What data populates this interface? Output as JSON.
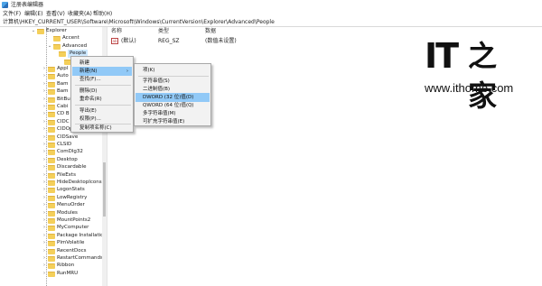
{
  "window": {
    "title": "注册表编辑器"
  },
  "menubar": [
    "文件(F)",
    "编辑(E)",
    "查看(V)",
    "收藏夹(A)",
    "帮助(H)"
  ],
  "address": "计算机\\HKEY_CURRENT_USER\\Software\\Microsoft\\Windows\\CurrentVersion\\Explorer\\Advanced\\People",
  "tree": {
    "items": [
      {
        "label": "Explorer",
        "expander": "⌄"
      },
      {
        "label": "Accent",
        "expander": ""
      },
      {
        "label": "Advanced",
        "expander": "⌄"
      },
      {
        "label": "People",
        "expander": ""
      },
      {
        "label": "Xa",
        "expander": ""
      },
      {
        "label": "Appl",
        "expander": "›"
      },
      {
        "label": "Auto",
        "expander": "›"
      },
      {
        "label": "Bam",
        "expander": "›"
      },
      {
        "label": "Bam",
        "expander": "›"
      },
      {
        "label": "BitBu",
        "expander": "›"
      },
      {
        "label": "Cabi",
        "expander": "›"
      },
      {
        "label": "CD B",
        "expander": "›"
      },
      {
        "label": "CIDC",
        "expander": "›"
      },
      {
        "label": "CIDOpen",
        "expander": "›"
      },
      {
        "label": "CIDSave",
        "expander": "›"
      },
      {
        "label": "CLSID",
        "expander": "›"
      },
      {
        "label": "ComDlg32",
        "expander": "›"
      },
      {
        "label": "Desktop",
        "expander": "›"
      },
      {
        "label": "Discardable",
        "expander": "›"
      },
      {
        "label": "FileExts",
        "expander": "›"
      },
      {
        "label": "HideDesktopIcons",
        "expander": "›"
      },
      {
        "label": "LogonStats",
        "expander": "›"
      },
      {
        "label": "LowRegistry",
        "expander": "›"
      },
      {
        "label": "MenuOrder",
        "expander": "›"
      },
      {
        "label": "Modules",
        "expander": "›"
      },
      {
        "label": "MountPoints2",
        "expander": "›"
      },
      {
        "label": "MyComputer",
        "expander": "›"
      },
      {
        "label": "Package Installatio",
        "expander": "›"
      },
      {
        "label": "PlmVolatile",
        "expander": "›"
      },
      {
        "label": "RecentDocs",
        "expander": "›"
      },
      {
        "label": "RestartCommands",
        "expander": "›"
      },
      {
        "label": "Ribbon",
        "expander": "›"
      },
      {
        "label": "RunMRU",
        "expander": "›"
      }
    ]
  },
  "list": {
    "headers": {
      "name": "名称",
      "type": "类型",
      "data": "数据"
    },
    "rows": [
      {
        "icon": "ab",
        "name": "(默认)",
        "type": "REG_SZ",
        "data": "(数值未设置)"
      }
    ]
  },
  "context_menu": {
    "items": [
      "新建(N)",
      "查找(F)...",
      "删除(D)",
      "重命名(R)",
      "导出(E)",
      "权限(P)...",
      "复制项名称(C)"
    ],
    "header_label": "新建",
    "submenu_arrow": "›"
  },
  "submenu": {
    "items": [
      "项(K)",
      "字符串值(S)",
      "二进制值(B)",
      "DWORD (32 位)值(D)",
      "QWORD (64 位)值(Q)",
      "多字符串值(M)",
      "可扩充字符串值(E)"
    ]
  },
  "watermark": {
    "logo_it": "IT",
    "logo_cn": "之家",
    "url": "www.ithome.com"
  }
}
